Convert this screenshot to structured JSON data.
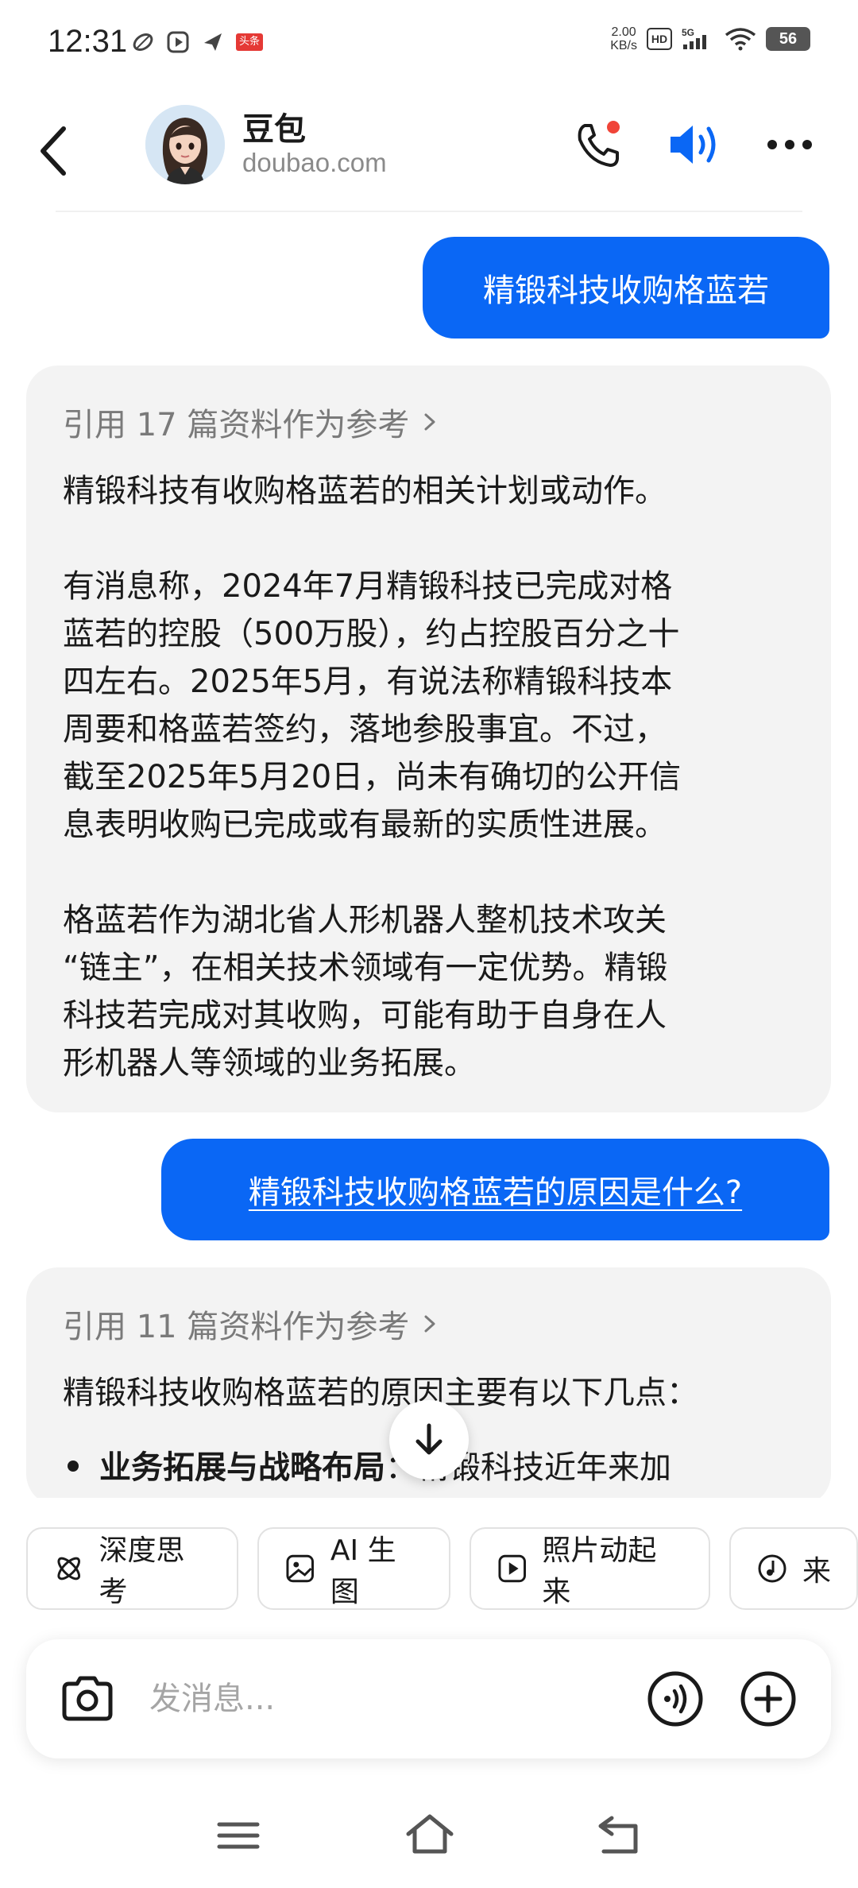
{
  "status_bar": {
    "time": "12:31",
    "net_speed_value": "2.00",
    "net_speed_unit": "KB/s",
    "hd": "HD",
    "signal_label": "5G",
    "battery": "56",
    "news_badge": "头条"
  },
  "header": {
    "bot_name": "豆包",
    "bot_domain": "doubao.com"
  },
  "conversation": {
    "user_message_1": "精锻科技收购格蓝若",
    "bot_answer_1": {
      "reference": "引用 17 篇资料作为参考",
      "text": "精锻科技有收购格蓝若的相关计划或动作。\n\n有消息称，2024年7月精锻科技已完成对格\n蓝若的控股（500万股），约占控股百分之十\n四左右。2025年5月，有说法称精锻科技本\n周要和格蓝若签约，落地参股事宜。不过，\n截至2025年5月20日，尚未有确切的公开信\n息表明收购已完成或有最新的实质性进展。\n\n格蓝若作为湖北省人形机器人整机技术攻关\n“链主”，在相关技术领域有一定优势。精锻\n科技若完成对其收购，可能有助于自身在人\n形机器人等领域的业务拓展。"
    },
    "user_message_2": "精锻科技收购格蓝若的原因是什么?",
    "bot_answer_2": {
      "reference": "引用 11 篇资料作为参考",
      "intro": "精锻科技收购格蓝若的原因主要有以下几点：",
      "bullet_title": "业务拓展与战略布局",
      "bullet_text": "：精锻科技近年来加"
    }
  },
  "features": [
    {
      "label": "深度思考",
      "icon": "atom-icon"
    },
    {
      "label": "AI 生图",
      "icon": "image-icon"
    },
    {
      "label": "照片动起来",
      "icon": "play-icon"
    },
    {
      "label": "来",
      "icon": "music-icon"
    }
  ],
  "input": {
    "placeholder": "发消息..."
  },
  "colors": {
    "accent": "#0a67f5",
    "card_bg": "#f3f3f3",
    "notification_dot": "#f04438"
  }
}
